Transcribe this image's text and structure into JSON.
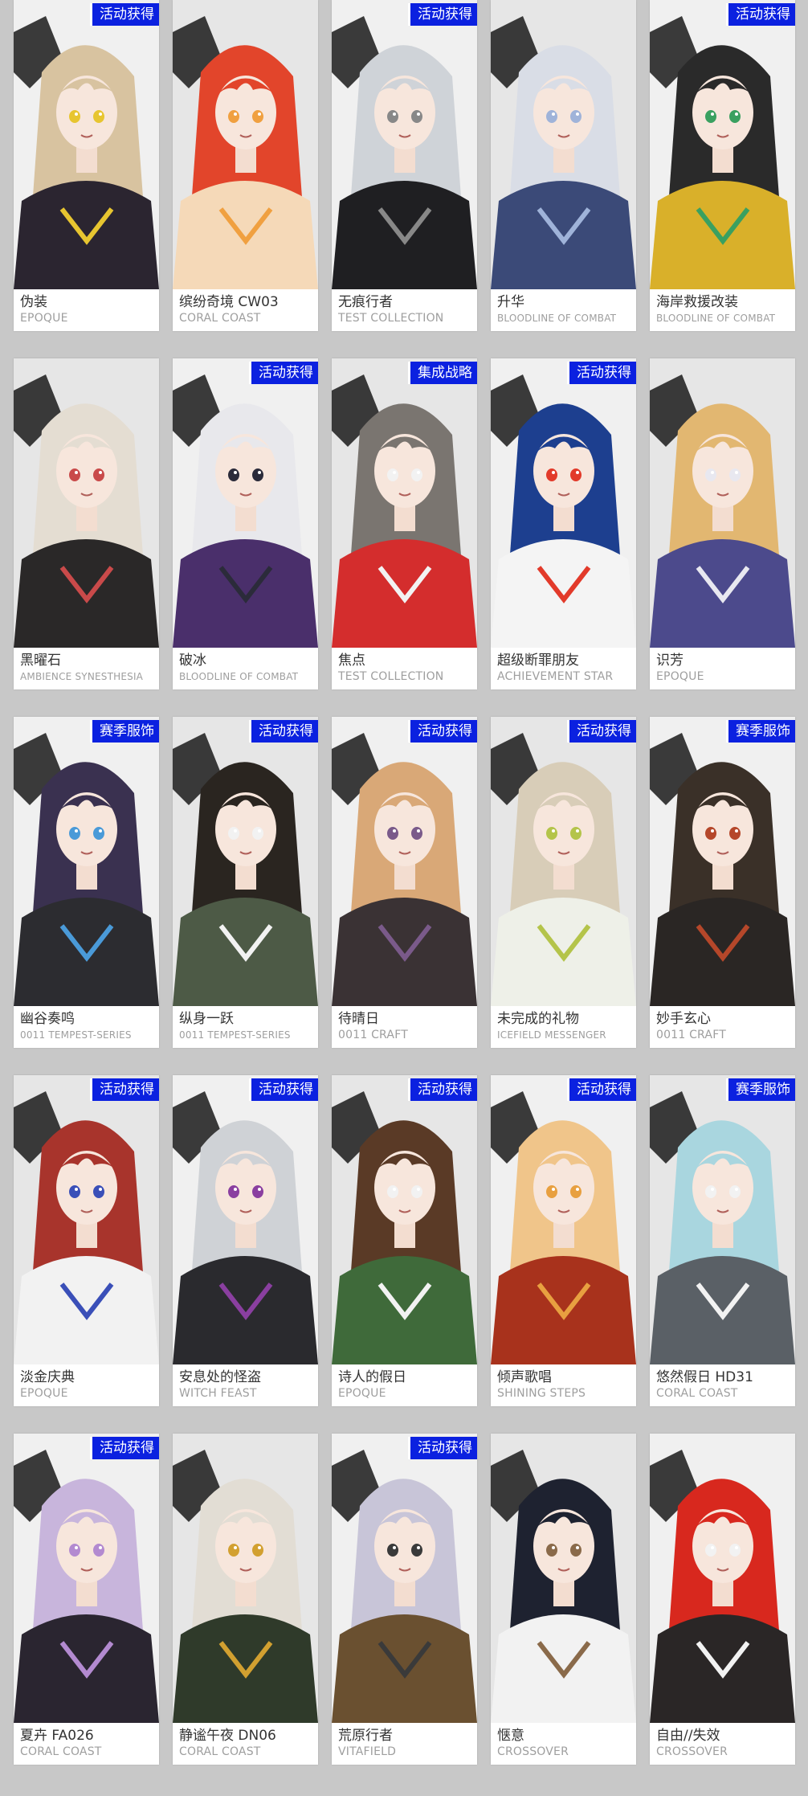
{
  "colors": {
    "background": "#c8c8c8",
    "card": "#ffffff",
    "badge": "#0b21e0",
    "name_text": "#333333",
    "series_text": "#9e9e9e"
  },
  "cards": [
    {
      "name": "伪装",
      "series": "EPOQUE",
      "badge": "活动获得",
      "hair": "#d8c3a0",
      "outfit": "#2b2530",
      "accent": "#e7c530"
    },
    {
      "name": "缤纷奇境 CW03",
      "series": "CORAL COAST",
      "badge": "",
      "hair": "#e2452b",
      "outfit": "#f5d9b8",
      "accent": "#f0a040"
    },
    {
      "name": "无痕行者",
      "series": "TEST COLLECTION",
      "badge": "活动获得",
      "hair": "#cfd3d8",
      "outfit": "#1f1f22",
      "accent": "#888888"
    },
    {
      "name": "升华",
      "series": "BLOODLINE OF COMBAT",
      "badge": "",
      "hair": "#d9dde6",
      "outfit": "#3b4a78",
      "accent": "#9fb3d9"
    },
    {
      "name": "海岸救援改装",
      "series": "BLOODLINE OF COMBAT",
      "badge": "活动获得",
      "hair": "#2a2a2a",
      "outfit": "#d9b02a",
      "accent": "#3aa060"
    },
    {
      "name": "黑曜石",
      "series": "AMBIENCE SYNESTHESIA",
      "badge": "",
      "hair": "#e4ddd2",
      "outfit": "#2a2828",
      "accent": "#c94a4a"
    },
    {
      "name": "破冰",
      "series": "BLOODLINE OF COMBAT",
      "badge": "活动获得",
      "hair": "#e8e8ec",
      "outfit": "#4a2f6b",
      "accent": "#2b2b3a"
    },
    {
      "name": "焦点",
      "series": "TEST COLLECTION",
      "badge": "集成战略",
      "hair": "#7a7570",
      "outfit": "#d42d2d",
      "accent": "#f2f2f2"
    },
    {
      "name": "超级断罪朋友",
      "series": "ACHIEVEMENT STAR",
      "badge": "活动获得",
      "hair": "#1d3f8f",
      "outfit": "#f4f4f4",
      "accent": "#e23a2a"
    },
    {
      "name": "识芳",
      "series": "EPOQUE",
      "badge": "",
      "hair": "#e2b771",
      "outfit": "#4c4a8c",
      "accent": "#e8e8f0"
    },
    {
      "name": "幽谷奏鸣",
      "series": "0011 TEMPEST-SERIES",
      "badge": "赛季服饰",
      "hair": "#3a3150",
      "outfit": "#2c2c30",
      "accent": "#4a9ad8"
    },
    {
      "name": "纵身一跃",
      "series": "0011 TEMPEST-SERIES",
      "badge": "活动获得",
      "hair": "#2a2520",
      "outfit": "#4d5a46",
      "accent": "#f2f2f2"
    },
    {
      "name": "待晴日",
      "series": "0011 CRAFT",
      "badge": "活动获得",
      "hair": "#d9a877",
      "outfit": "#3a3234",
      "accent": "#7a5a8a"
    },
    {
      "name": "未完成的礼物",
      "series": "ICEFIELD MESSENGER",
      "badge": "活动获得",
      "hair": "#d8cdb8",
      "outfit": "#eef0e8",
      "accent": "#b4c44a"
    },
    {
      "name": "妙手玄心",
      "series": "0011 CRAFT",
      "badge": "赛季服饰",
      "hair": "#3a3028",
      "outfit": "#2a2624",
      "accent": "#b5472a"
    },
    {
      "name": "淡金庆典",
      "series": "EPOQUE",
      "badge": "活动获得",
      "hair": "#a8342c",
      "outfit": "#f2f2f2",
      "accent": "#3a4fb8"
    },
    {
      "name": "安息处的怪盗",
      "series": "WITCH FEAST",
      "badge": "活动获得",
      "hair": "#cfd2d6",
      "outfit": "#2a2a2e",
      "accent": "#8a3fa0"
    },
    {
      "name": "诗人的假日",
      "series": "EPOQUE",
      "badge": "活动获得",
      "hair": "#5a3a26",
      "outfit": "#3f6a3a",
      "accent": "#f2f2f2"
    },
    {
      "name": "倾声歌唱",
      "series": "SHINING STEPS",
      "badge": "活动获得",
      "hair": "#f0c58a",
      "outfit": "#a8321c",
      "accent": "#e8a040"
    },
    {
      "name": "悠然假日 HD31",
      "series": "CORAL COAST",
      "badge": "赛季服饰",
      "hair": "#a9d6df",
      "outfit": "#5a6066",
      "accent": "#f2f2f2"
    },
    {
      "name": "夏卉 FA026",
      "series": "CORAL COAST",
      "badge": "活动获得",
      "hair": "#c8b5dc",
      "outfit": "#2a2530",
      "accent": "#b38ad0"
    },
    {
      "name": "静谧午夜 DN06",
      "series": "CORAL COAST",
      "badge": "",
      "hair": "#e2ddd4",
      "outfit": "#2f3a2a",
      "accent": "#d2a030"
    },
    {
      "name": "荒原行者",
      "series": "VITAFIELD",
      "badge": "活动获得",
      "hair": "#c8c5d8",
      "outfit": "#6a5030",
      "accent": "#3a3a3a"
    },
    {
      "name": "惬意",
      "series": "CROSSOVER",
      "badge": "",
      "hair": "#1e2230",
      "outfit": "#f2f2f2",
      "accent": "#8a6a4a"
    },
    {
      "name": "自由//失效",
      "series": "CROSSOVER",
      "badge": "",
      "hair": "#d8281e",
      "outfit": "#2a2626",
      "accent": "#f2f2f2"
    }
  ]
}
